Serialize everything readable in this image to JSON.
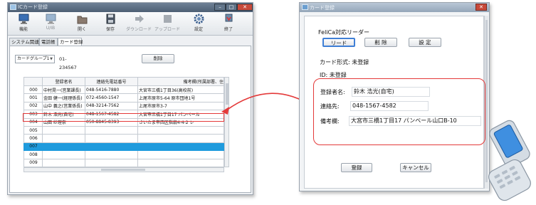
{
  "main_window": {
    "title": "ICカード登録",
    "toolbar": [
      {
        "id": "system",
        "label": "機能"
      },
      {
        "id": "ic",
        "label": "U/IB"
      },
      {
        "id": "open",
        "label": "開く"
      },
      {
        "id": "save",
        "label": "保存"
      },
      {
        "id": "download",
        "label": "ダウンロード"
      },
      {
        "id": "upload",
        "label": "アップロード"
      },
      {
        "id": "settings",
        "label": "設定"
      },
      {
        "id": "exit",
        "label": "終了"
      }
    ],
    "tabs": [
      "システム関連",
      "電話帳",
      "カード登録"
    ],
    "group_select": "カードグループ1",
    "group_code": "01-234567",
    "delete_button": "削除",
    "table": {
      "headers": [
        "",
        "登録者名",
        "連絡先電話番号",
        "備考欄(所属部署、住"
      ],
      "rows": [
        [
          "000",
          "中村晃一(営業課長)",
          "048-5416-7880",
          "大宮市三橋1丁目36(高校前)"
        ],
        [
          "001",
          "金田 健一(経理係長)",
          "072-4560-1547",
          "上尾市原市5-64 原市団地1号"
        ],
        [
          "002",
          "山中 義之(営業係長)",
          "048-3214-7562",
          "上尾市原市3-7"
        ],
        [
          "003",
          "鈴木 浩光(自宅)",
          "048-1567-4582",
          "大宮市三橋1丁目17 パンベール"
        ],
        [
          "004",
          "山田 紗理奈",
          "050-8845-8393",
          "さいたま市西区指扇4-4-2 レ"
        ],
        [
          "005",
          "",
          "",
          ""
        ],
        [
          "006",
          "",
          "",
          ""
        ],
        [
          "007",
          "",
          "",
          ""
        ],
        [
          "008",
          "",
          "",
          ""
        ],
        [
          "009",
          "",
          "",
          ""
        ]
      ]
    }
  },
  "dialog": {
    "title": "カード登録",
    "felica_title": "FeliCa対応リーダー",
    "buttons": {
      "read": "リード",
      "delete": "削 除",
      "settings": "設 定",
      "register": "登録",
      "cancel": "キャンセル"
    },
    "card_format": "カード形式: 未登録",
    "id_line": "ID: 未登録",
    "name_label": "登録者名:",
    "name_value": "鈴木 浩光(自宅)",
    "contact_label": "連絡先:",
    "contact_value": "048-1567-4582",
    "note_label": "備考欄:",
    "note_value": "大宮市三橋1丁目17 パンベール山口B-10"
  },
  "colors": {
    "highlight_red": "#e43a3a",
    "selected_row": "#1f9bdd"
  }
}
